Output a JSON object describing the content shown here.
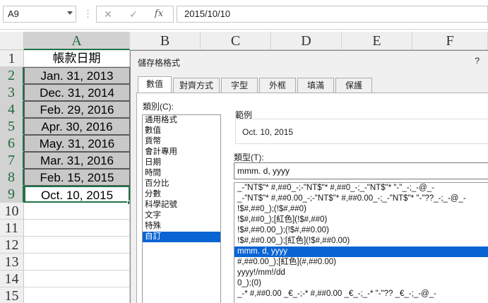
{
  "formula_bar": {
    "name_box": "A9",
    "dots": "⋮",
    "cancel_glyph": "✕",
    "enter_glyph": "✓",
    "fx_glyph": "fx",
    "formula": "2015/10/10"
  },
  "columns": [
    "A",
    "B",
    "C",
    "D",
    "E",
    "F"
  ],
  "rows": [
    "1",
    "2",
    "3",
    "4",
    "5",
    "6",
    "7",
    "8",
    "9",
    "10",
    "11",
    "12",
    "13",
    "14",
    "15"
  ],
  "cells": {
    "header": "帳款日期",
    "dates": [
      "Jan. 31, 2013",
      "Dec. 31, 2014",
      "Feb. 29, 2016",
      "Apr. 30, 2016",
      "May. 31, 2016",
      "Mar. 31, 2016",
      "Feb. 15, 2015",
      "Oct. 10, 2015"
    ]
  },
  "dialog": {
    "title": "儲存格格式",
    "help": "?",
    "tabs": [
      "數值",
      "對齊方式",
      "字型",
      "外框",
      "填滿",
      "保護"
    ],
    "active_tab": "數值",
    "category_label": "類別(C):",
    "categories": [
      "通用格式",
      "數值",
      "貨幣",
      "會計專用",
      "日期",
      "時間",
      "百分比",
      "分數",
      "科學記號",
      "文字",
      "特殊",
      "自訂"
    ],
    "selected_category": "自訂",
    "sample_label": "範例",
    "sample_value": "Oct. 10, 2015",
    "type_label": "類型(T):",
    "type_value": "mmm. d, yyyy",
    "format_list": [
      "_-\"NT$\"* #,##0_-;-\"NT$\"* #,##0_-;_-\"NT$\"* \"-\"_-;_-@_-",
      "_-\"NT$\"* #,##0.00_-;-\"NT$\"* #,##0.00_-;_-\"NT$\"* \"-\"??_-;_-@_-",
      "!$#,##0_);(!$#,##0)",
      "!$#,##0_);[紅色](!$#,##0)",
      "!$#,##0.00_);(!$#,##0.00)",
      "!$#,##0.00_);[紅色](!$#,##0.00)",
      "mmm. d, yyyy",
      "#,##0.00_);[紅色](#,##0.00)",
      " yyyy!/mm!/dd",
      "0_);(0)",
      "_-* #,##0.00 _€_-;-* #,##0.00 _€_-;_-* \"-\"?? _€_-;_-@_-"
    ],
    "selected_format": "mmm. d, yyyy"
  },
  "colors": {
    "accent": "#217346",
    "selection": "#0a64d2",
    "shaded_cell": "#c8c8c8"
  }
}
